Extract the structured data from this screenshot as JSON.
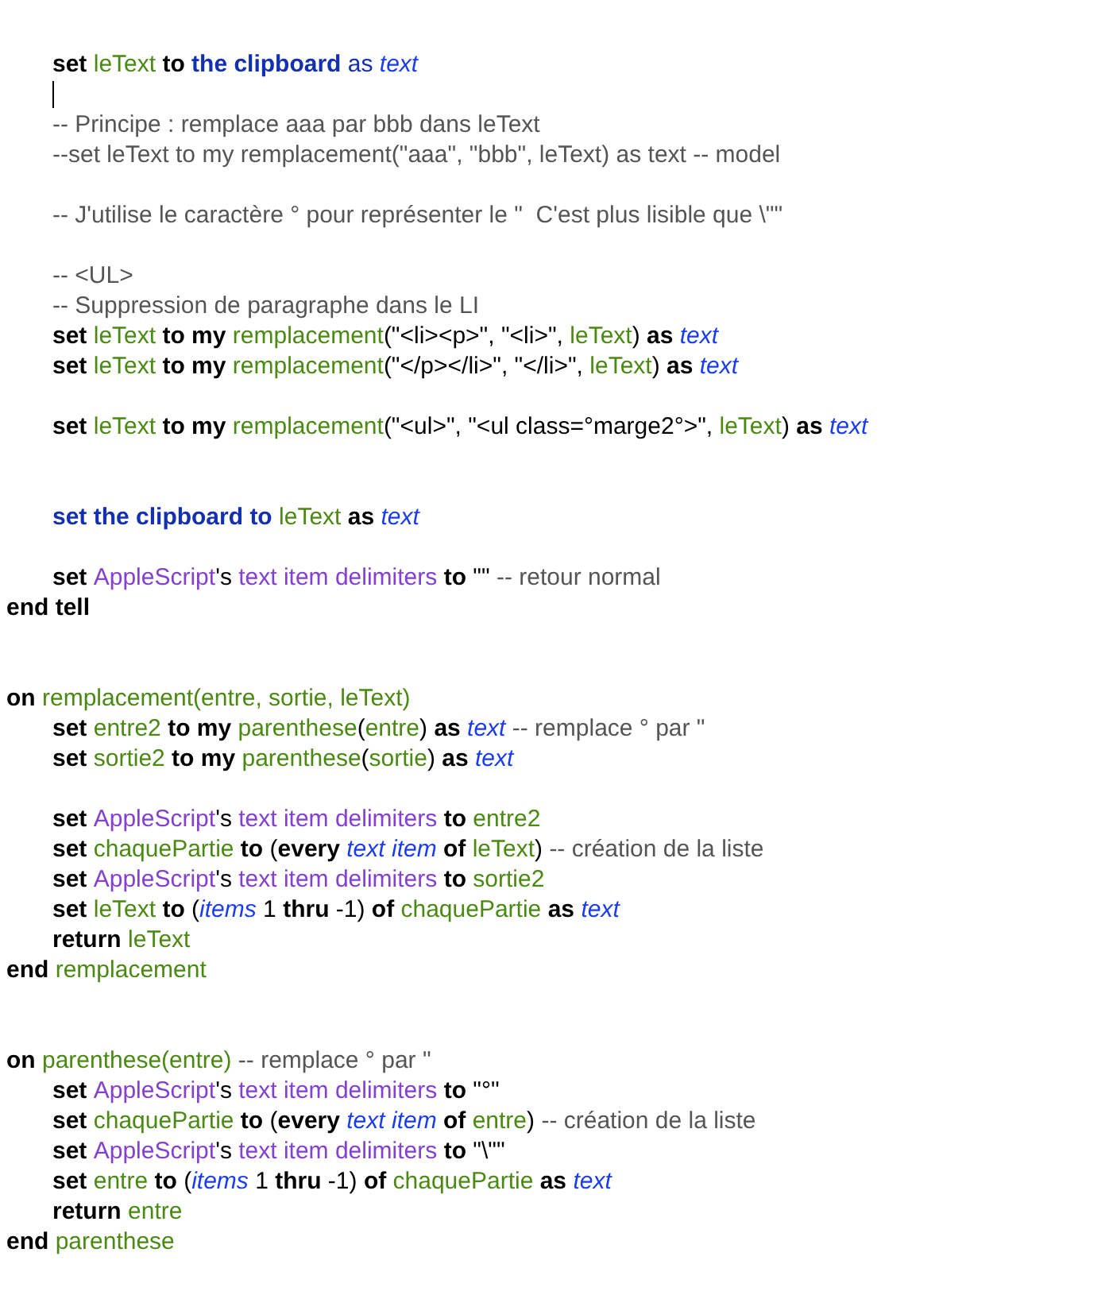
{
  "script": [
    {
      "kind": "block",
      "children": [
        {
          "kind": "code",
          "tokens": [
            {
              "kind": "keyword",
              "text": "set "
            },
            {
              "kind": "variable",
              "text": "leText"
            },
            {
              "kind": "keyword",
              "text": " to "
            },
            {
              "kind": "app-keyword",
              "text": "the clipboard"
            },
            {
              "kind": "app-plain",
              "text": " as "
            },
            {
              "kind": "class",
              "text": "text"
            }
          ]
        },
        {
          "kind": "caret"
        },
        {
          "kind": "code",
          "tokens": [
            {
              "kind": "comment",
              "text": "-- Principe : remplace aaa par bbb dans leText"
            }
          ]
        },
        {
          "kind": "code",
          "tokens": [
            {
              "kind": "comment",
              "text": "--set leText to my remplacement(\"aaa\", \"bbb\", leText) as text -- model"
            }
          ]
        },
        {
          "kind": "blank"
        },
        {
          "kind": "code",
          "tokens": [
            {
              "kind": "comment",
              "text": "-- J'utilise le caractère ° pour représenter le \"  C'est plus lisible que \\\"\""
            }
          ]
        },
        {
          "kind": "blank"
        },
        {
          "kind": "code",
          "tokens": [
            {
              "kind": "comment",
              "text": "-- <UL>"
            }
          ]
        },
        {
          "kind": "code",
          "tokens": [
            {
              "kind": "comment",
              "text": "-- Suppression de paragraphe dans le LI"
            }
          ]
        },
        {
          "kind": "code",
          "tokens": [
            {
              "kind": "keyword",
              "text": "set "
            },
            {
              "kind": "variable",
              "text": "leText"
            },
            {
              "kind": "keyword",
              "text": " to my "
            },
            {
              "kind": "variable",
              "text": "remplacement"
            },
            {
              "kind": "plain",
              "text": "(\"<li><p>\", \"<li>\", "
            },
            {
              "kind": "variable",
              "text": "leText"
            },
            {
              "kind": "plain",
              "text": ") "
            },
            {
              "kind": "keyword",
              "text": "as "
            },
            {
              "kind": "class",
              "text": "text"
            }
          ]
        },
        {
          "kind": "code",
          "tokens": [
            {
              "kind": "keyword",
              "text": "set "
            },
            {
              "kind": "variable",
              "text": "leText"
            },
            {
              "kind": "keyword",
              "text": " to my "
            },
            {
              "kind": "variable",
              "text": "remplacement"
            },
            {
              "kind": "plain",
              "text": "(\"</p></li>\", \"</li>\", "
            },
            {
              "kind": "variable",
              "text": "leText"
            },
            {
              "kind": "plain",
              "text": ") "
            },
            {
              "kind": "keyword",
              "text": "as "
            },
            {
              "kind": "class",
              "text": "text"
            }
          ]
        },
        {
          "kind": "blank"
        },
        {
          "kind": "code",
          "tokens": [
            {
              "kind": "keyword",
              "text": "set "
            },
            {
              "kind": "variable",
              "text": "leText"
            },
            {
              "kind": "keyword",
              "text": " to my "
            },
            {
              "kind": "variable",
              "text": "remplacement"
            },
            {
              "kind": "plain",
              "text": "(\"<ul>\", \"<ul class=°marge2°>\", "
            },
            {
              "kind": "variable",
              "text": "leText"
            },
            {
              "kind": "plain",
              "text": ") "
            },
            {
              "kind": "keyword",
              "text": "as "
            },
            {
              "kind": "class",
              "text": "text"
            }
          ]
        },
        {
          "kind": "blank"
        },
        {
          "kind": "blank"
        },
        {
          "kind": "code",
          "tokens": [
            {
              "kind": "app-keyword",
              "text": "set the clipboard to "
            },
            {
              "kind": "variable",
              "text": "leText"
            },
            {
              "kind": "keyword",
              "text": " as "
            },
            {
              "kind": "class",
              "text": "text"
            }
          ]
        },
        {
          "kind": "blank"
        },
        {
          "kind": "code",
          "tokens": [
            {
              "kind": "keyword",
              "text": "set "
            },
            {
              "kind": "property",
              "text": "AppleScript"
            },
            {
              "kind": "plain",
              "text": "'s "
            },
            {
              "kind": "property",
              "text": "text item delimiters"
            },
            {
              "kind": "keyword",
              "text": " to "
            },
            {
              "kind": "plain",
              "text": "\"\" "
            },
            {
              "kind": "comment",
              "text": "-- retour normal"
            }
          ]
        }
      ]
    },
    {
      "kind": "code",
      "tokens": [
        {
          "kind": "keyword",
          "text": "end tell"
        }
      ]
    },
    {
      "kind": "blank"
    },
    {
      "kind": "blank"
    },
    {
      "kind": "code",
      "tokens": [
        {
          "kind": "keyword",
          "text": "on "
        },
        {
          "kind": "variable",
          "text": "remplacement(entre, sortie, leText)"
        }
      ],
      "children": [
        {
          "kind": "code",
          "tokens": [
            {
              "kind": "keyword",
              "text": "set "
            },
            {
              "kind": "variable",
              "text": "entre2"
            },
            {
              "kind": "keyword",
              "text": " to my "
            },
            {
              "kind": "variable",
              "text": "parenthese"
            },
            {
              "kind": "plain",
              "text": "("
            },
            {
              "kind": "variable",
              "text": "entre"
            },
            {
              "kind": "plain",
              "text": ") "
            },
            {
              "kind": "keyword",
              "text": "as "
            },
            {
              "kind": "class",
              "text": "text"
            },
            {
              "kind": "comment",
              "text": " -- remplace ° par \""
            }
          ]
        },
        {
          "kind": "code",
          "tokens": [
            {
              "kind": "keyword",
              "text": "set "
            },
            {
              "kind": "variable",
              "text": "sortie2"
            },
            {
              "kind": "keyword",
              "text": " to my "
            },
            {
              "kind": "variable",
              "text": "parenthese"
            },
            {
              "kind": "plain",
              "text": "("
            },
            {
              "kind": "variable",
              "text": "sortie"
            },
            {
              "kind": "plain",
              "text": ") "
            },
            {
              "kind": "keyword",
              "text": "as "
            },
            {
              "kind": "class",
              "text": "text"
            }
          ]
        },
        {
          "kind": "blank"
        },
        {
          "kind": "code",
          "tokens": [
            {
              "kind": "keyword",
              "text": "set "
            },
            {
              "kind": "property",
              "text": "AppleScript"
            },
            {
              "kind": "plain",
              "text": "'s "
            },
            {
              "kind": "property",
              "text": "text item delimiters"
            },
            {
              "kind": "keyword",
              "text": " to "
            },
            {
              "kind": "variable",
              "text": "entre2"
            }
          ]
        },
        {
          "kind": "code",
          "tokens": [
            {
              "kind": "keyword",
              "text": "set "
            },
            {
              "kind": "variable",
              "text": "chaquePartie"
            },
            {
              "kind": "keyword",
              "text": " to "
            },
            {
              "kind": "plain",
              "text": "("
            },
            {
              "kind": "keyword",
              "text": "every "
            },
            {
              "kind": "class",
              "text": "text item"
            },
            {
              "kind": "keyword",
              "text": " of "
            },
            {
              "kind": "variable",
              "text": "leText"
            },
            {
              "kind": "plain",
              "text": ") "
            },
            {
              "kind": "comment",
              "text": "-- création de la liste"
            }
          ]
        },
        {
          "kind": "code",
          "tokens": [
            {
              "kind": "keyword",
              "text": "set "
            },
            {
              "kind": "property",
              "text": "AppleScript"
            },
            {
              "kind": "plain",
              "text": "'s "
            },
            {
              "kind": "property",
              "text": "text item delimiters"
            },
            {
              "kind": "keyword",
              "text": " to "
            },
            {
              "kind": "variable",
              "text": "sortie2"
            }
          ]
        },
        {
          "kind": "code",
          "tokens": [
            {
              "kind": "keyword",
              "text": "set "
            },
            {
              "kind": "variable",
              "text": "leText"
            },
            {
              "kind": "keyword",
              "text": " to "
            },
            {
              "kind": "plain",
              "text": "("
            },
            {
              "kind": "class",
              "text": "items"
            },
            {
              "kind": "plain",
              "text": " 1 "
            },
            {
              "kind": "keyword",
              "text": "thru"
            },
            {
              "kind": "plain",
              "text": " -1) "
            },
            {
              "kind": "keyword",
              "text": "of "
            },
            {
              "kind": "variable",
              "text": "chaquePartie"
            },
            {
              "kind": "keyword",
              "text": " as "
            },
            {
              "kind": "class",
              "text": "text"
            }
          ]
        },
        {
          "kind": "code",
          "tokens": [
            {
              "kind": "keyword",
              "text": "return "
            },
            {
              "kind": "variable",
              "text": "leText"
            }
          ]
        }
      ]
    },
    {
      "kind": "code",
      "tokens": [
        {
          "kind": "keyword",
          "text": "end "
        },
        {
          "kind": "variable",
          "text": "remplacement"
        }
      ]
    },
    {
      "kind": "blank"
    },
    {
      "kind": "blank"
    },
    {
      "kind": "code",
      "tokens": [
        {
          "kind": "keyword",
          "text": "on "
        },
        {
          "kind": "variable",
          "text": "parenthese(entre)"
        },
        {
          "kind": "comment",
          "text": " -- remplace ° par \""
        }
      ],
      "children": [
        {
          "kind": "code",
          "tokens": [
            {
              "kind": "keyword",
              "text": "set "
            },
            {
              "kind": "property",
              "text": "AppleScript"
            },
            {
              "kind": "plain",
              "text": "'s "
            },
            {
              "kind": "property",
              "text": "text item delimiters"
            },
            {
              "kind": "keyword",
              "text": " to "
            },
            {
              "kind": "plain",
              "text": "\"°\""
            }
          ]
        },
        {
          "kind": "code",
          "tokens": [
            {
              "kind": "keyword",
              "text": "set "
            },
            {
              "kind": "variable",
              "text": "chaquePartie"
            },
            {
              "kind": "keyword",
              "text": " to "
            },
            {
              "kind": "plain",
              "text": "("
            },
            {
              "kind": "keyword",
              "text": "every "
            },
            {
              "kind": "class",
              "text": "text item"
            },
            {
              "kind": "keyword",
              "text": " of "
            },
            {
              "kind": "variable",
              "text": "entre"
            },
            {
              "kind": "plain",
              "text": ") "
            },
            {
              "kind": "comment",
              "text": "-- création de la liste"
            }
          ]
        },
        {
          "kind": "code",
          "tokens": [
            {
              "kind": "keyword",
              "text": "set "
            },
            {
              "kind": "property",
              "text": "AppleScript"
            },
            {
              "kind": "plain",
              "text": "'s "
            },
            {
              "kind": "property",
              "text": "text item delimiters"
            },
            {
              "kind": "keyword",
              "text": " to "
            },
            {
              "kind": "plain",
              "text": "\"\\\"\""
            }
          ]
        },
        {
          "kind": "code",
          "tokens": [
            {
              "kind": "keyword",
              "text": "set "
            },
            {
              "kind": "variable",
              "text": "entre"
            },
            {
              "kind": "keyword",
              "text": " to "
            },
            {
              "kind": "plain",
              "text": "("
            },
            {
              "kind": "class",
              "text": "items"
            },
            {
              "kind": "plain",
              "text": " 1 "
            },
            {
              "kind": "keyword",
              "text": "thru"
            },
            {
              "kind": "plain",
              "text": " -1) "
            },
            {
              "kind": "keyword",
              "text": "of "
            },
            {
              "kind": "variable",
              "text": "chaquePartie"
            },
            {
              "kind": "keyword",
              "text": " as "
            },
            {
              "kind": "class",
              "text": "text"
            }
          ]
        },
        {
          "kind": "code",
          "tokens": [
            {
              "kind": "keyword",
              "text": "return "
            },
            {
              "kind": "variable",
              "text": "entre"
            }
          ]
        }
      ]
    },
    {
      "kind": "code",
      "tokens": [
        {
          "kind": "keyword",
          "text": "end "
        },
        {
          "kind": "variable",
          "text": "parenthese"
        }
      ]
    }
  ]
}
